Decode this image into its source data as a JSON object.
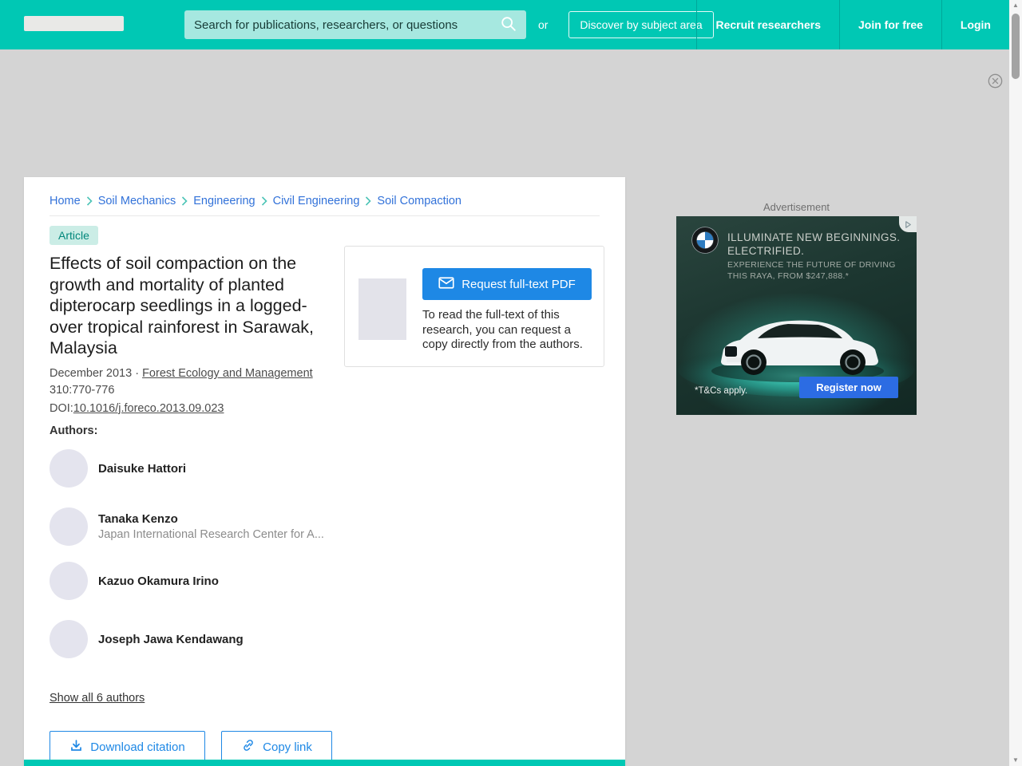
{
  "header": {
    "search_placeholder": "Search for publications, researchers, or questions",
    "or_label": "or",
    "discover_label": "Discover by subject area",
    "nav": [
      {
        "label": "Recruit researchers"
      },
      {
        "label": "Join for free"
      },
      {
        "label": "Login"
      }
    ]
  },
  "breadcrumb": {
    "items": [
      {
        "label": "Home"
      },
      {
        "label": "Soil Mechanics"
      },
      {
        "label": "Engineering"
      },
      {
        "label": "Civil Engineering"
      },
      {
        "label": "Soil Compaction"
      }
    ]
  },
  "article": {
    "badge_label": "Article",
    "title": "Effects of soil compaction on the growth and mortality of planted dipterocarp seedlings in a logged-over tropical rainforest in Sarawak, Malaysia",
    "date": "December 2013",
    "dot": "·",
    "journal": "Forest Ecology and Management",
    "volume_pages": "310:770-776",
    "doi_label": "DOI:",
    "doi_value": "10.1016/j.foreco.2013.09.023",
    "authors_label": "Authors:",
    "authors": [
      {
        "name": "Daisuke Hattori"
      },
      {
        "name": "Tanaka Kenzo",
        "affiliation": "Japan International Research Center for A..."
      },
      {
        "name": "Kazuo Okamura Irino"
      },
      {
        "name": "Joseph Jawa Kendawang"
      }
    ],
    "show_all_label": "Show all 6 authors",
    "download_citation_label": "Download citation",
    "copy_link_label": "Copy link"
  },
  "request": {
    "button_label": "Request full-text PDF",
    "description": "To read the full-text of this research, you can request a copy directly from the authors."
  },
  "ad": {
    "label": "Advertisement",
    "headline_1": "ILLUMINATE NEW BEGINNINGS.",
    "headline_2": "ELECTRIFIED.",
    "subline_1": "EXPERIENCE THE FUTURE OF DRIVING",
    "subline_2": "THIS RAYA, FROM $247,888.*",
    "terms": "*T&Cs apply.",
    "cta_label": "Register now"
  },
  "colors": {
    "brand_teal": "#00C8B4",
    "header_separator": "#00A89A",
    "search_bg": "#A6E8E0",
    "action_blue": "#1E88E5",
    "breadcrumb_blue": "#3272D9",
    "badge_bg": "#CBEDE6",
    "badge_text": "#00877B",
    "ad_cta_blue": "#2C6CE3",
    "page_bg": "#D4D4D4",
    "avatar_bg": "#E4E4EE"
  }
}
